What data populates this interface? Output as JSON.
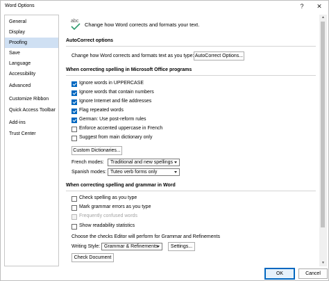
{
  "window": {
    "title": "Word Options",
    "help_glyph": "?",
    "close_glyph": "✕"
  },
  "sidebar": {
    "items": [
      {
        "label": "General",
        "selected": false
      },
      {
        "label": "Display",
        "selected": false
      },
      {
        "label": "Proofing",
        "selected": true
      },
      {
        "label": "Save",
        "selected": false
      },
      {
        "label": "Language",
        "selected": false
      },
      {
        "label": "Accessibility",
        "selected": false
      },
      {
        "label": "Advanced",
        "selected": false
      },
      {
        "label": "Customize Ribbon",
        "selected": false
      },
      {
        "label": "Quick Access Toolbar",
        "selected": false
      },
      {
        "label": "Add-ins",
        "selected": false
      },
      {
        "label": "Trust Center",
        "selected": false
      }
    ]
  },
  "header": {
    "icon_text": "abc",
    "text": "Change how Word corrects and formats your text."
  },
  "autocorrect": {
    "title": "AutoCorrect options",
    "description": "Change how Word corrects and formats text as you type:",
    "button_label": "AutoCorrect Options..."
  },
  "spelling_office": {
    "title": "When correcting spelling in Microsoft Office programs",
    "options": [
      {
        "label": "Ignore words in UPPERCASE",
        "checked": true,
        "disabled": false
      },
      {
        "label": "Ignore words that contain numbers",
        "checked": true,
        "disabled": false
      },
      {
        "label": "Ignore Internet and file addresses",
        "checked": true,
        "disabled": false
      },
      {
        "label": "Flag repeated words",
        "checked": true,
        "disabled": false
      },
      {
        "label": "German: Use post-reform rules",
        "checked": true,
        "disabled": false
      },
      {
        "label": "Enforce accented uppercase in French",
        "checked": false,
        "disabled": false
      },
      {
        "label": "Suggest from main dictionary only",
        "checked": false,
        "disabled": false
      }
    ],
    "custom_dictionaries_label": "Custom Dictionaries...",
    "french_modes_label": "French modes:",
    "french_modes_value": "Traditional and new spellings",
    "spanish_modes_label": "Spanish modes:",
    "spanish_modes_value": "Tuteo verb forms only"
  },
  "spelling_word": {
    "title": "When correcting spelling and grammar in Word",
    "options": [
      {
        "label": "Check spelling as you type",
        "checked": false,
        "disabled": false
      },
      {
        "label": "Mark grammar errors as you type",
        "checked": false,
        "disabled": false
      },
      {
        "label": "Frequently confused words",
        "checked": false,
        "disabled": true
      },
      {
        "label": "Show readability statistics",
        "checked": false,
        "disabled": false
      }
    ],
    "editor_description": "Choose the checks Editor will perform for Grammar and Refinements",
    "writing_style_label": "Writing Style:",
    "writing_style_value": "Grammar & Refinements",
    "settings_label": "Settings...",
    "check_document_label": "Check Document"
  },
  "footer": {
    "ok_label": "OK",
    "cancel_label": "Cancel"
  }
}
